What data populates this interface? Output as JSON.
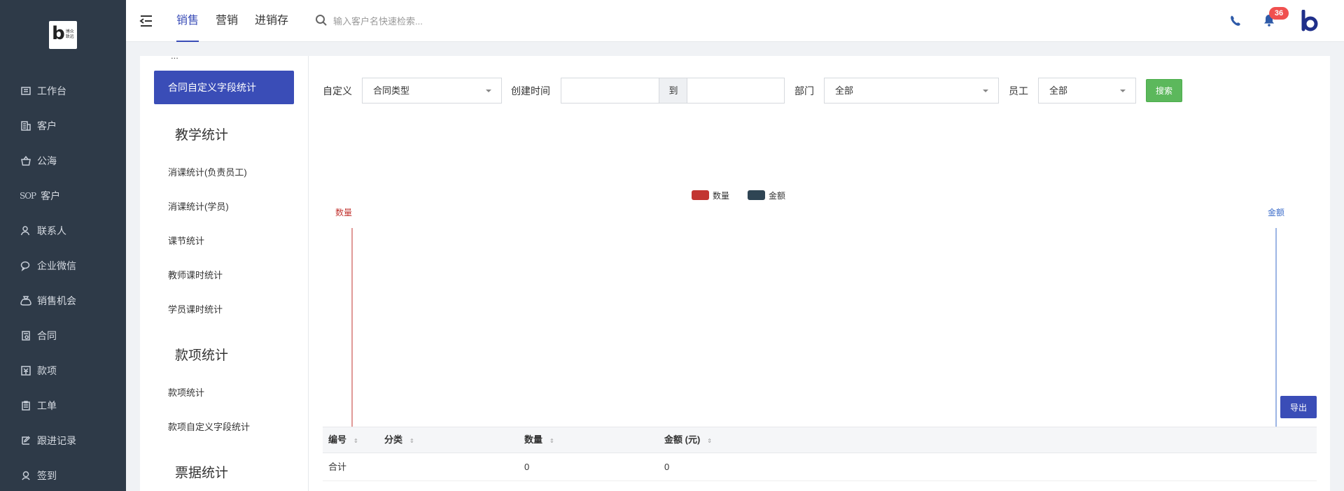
{
  "logo": {
    "main": "b",
    "line1": "博众",
    "line2": "致远"
  },
  "sidebar": {
    "items": [
      {
        "label": "工作台",
        "icon": "dashboard-icon"
      },
      {
        "label": "客户",
        "icon": "building-icon"
      },
      {
        "label": "公海",
        "icon": "basket-icon"
      },
      {
        "label": "客户SOP",
        "icon": "sop-icon",
        "prefix": "SOP"
      },
      {
        "label": "联系人",
        "icon": "user-icon"
      },
      {
        "label": "企业微信",
        "icon": "wechat-icon"
      },
      {
        "label": "销售机会",
        "icon": "money-bag-icon"
      },
      {
        "label": "合同",
        "icon": "contract-icon"
      },
      {
        "label": "款项",
        "icon": "payment-icon"
      },
      {
        "label": "工单",
        "icon": "work-order-icon"
      },
      {
        "label": "跟进记录",
        "icon": "edit-icon"
      },
      {
        "label": "签到",
        "icon": "location-icon"
      }
    ]
  },
  "header": {
    "tabs": [
      {
        "label": "销售",
        "active": true
      },
      {
        "label": "营销",
        "active": false
      },
      {
        "label": "进销存",
        "active": false
      }
    ],
    "search_placeholder": "输入客户名快速检索...",
    "notification_count": "36",
    "accent_color": "#3a4db7"
  },
  "categories": {
    "cut_label": "...",
    "active_label": "合同自定义字段统计",
    "groups": [
      {
        "title": "教学统计",
        "items": [
          "消课统计(负责员工)",
          "消课统计(学员)",
          "课节统计",
          "教师课时统计",
          "学员课时统计"
        ]
      },
      {
        "title": "款项统计",
        "items": [
          "款项统计",
          "款项自定义字段统计"
        ]
      },
      {
        "title": "票据统计",
        "items": []
      }
    ]
  },
  "filters": {
    "custom_label": "自定义",
    "custom_value": "合同类型",
    "created_label": "创建时间",
    "date_from": "",
    "date_sep": "到",
    "date_to": "",
    "dept_label": "部门",
    "dept_value": "全部",
    "staff_label": "员工",
    "staff_value": "全部",
    "search_button": "搜索"
  },
  "chart_data": {
    "type": "bar",
    "categories": [],
    "series": [
      {
        "name": "数量",
        "values": [],
        "color": "#c23531"
      },
      {
        "name": "金额",
        "values": [],
        "color": "#2f4554"
      }
    ],
    "left_axis_label": "数量",
    "right_axis_label": "金额",
    "legend_position": "top-center",
    "grid": false
  },
  "export_button": "导出",
  "table": {
    "columns": [
      "编号",
      "分类",
      "数量",
      "金额 (元)"
    ],
    "rows": [
      [
        "合计",
        "",
        "0",
        "0"
      ]
    ]
  }
}
